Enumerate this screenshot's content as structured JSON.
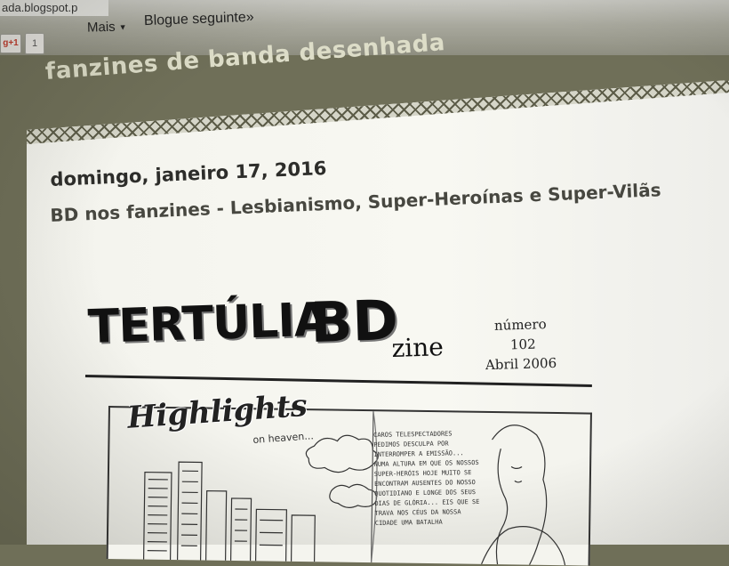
{
  "browser": {
    "url_fragment": "ada.blogspot.p"
  },
  "blogger_bar": {
    "gplus_label": "g+1",
    "gplus_count": "1",
    "more_label": "Mais",
    "next_blog_label": "Blogue seguinte»"
  },
  "blog": {
    "title": "fanzines de banda desenhada"
  },
  "post": {
    "date": "domingo, janeiro 17, 2016",
    "title": "BD nos fanzines - Lesbianismo, Super-Heroínas e Super-Vilãs"
  },
  "zine_image": {
    "title_main": "TERTÚLIA",
    "title_bd": "BD",
    "title_suffix": "zine",
    "issue_label": "número",
    "issue_number": "102",
    "issue_date": "Abril 2006",
    "comic_heading": "Highlights",
    "comic_subheading": "on heaven...",
    "speech_text": "Caros telespectadores pedimos desculpa por interromper a emissão... Numa altura em que os nossos super-heróis hoje muito se encontram ausentes do nosso quotidiano e longe dos seus dias de glória... eis que se trava nos céus da nossa cidade uma batalha"
  },
  "colors": {
    "header_bg": "#6f6f58",
    "header_text": "#ddddc8",
    "content_bg": "#f5f5ef",
    "post_text": "#2d2d2a"
  }
}
